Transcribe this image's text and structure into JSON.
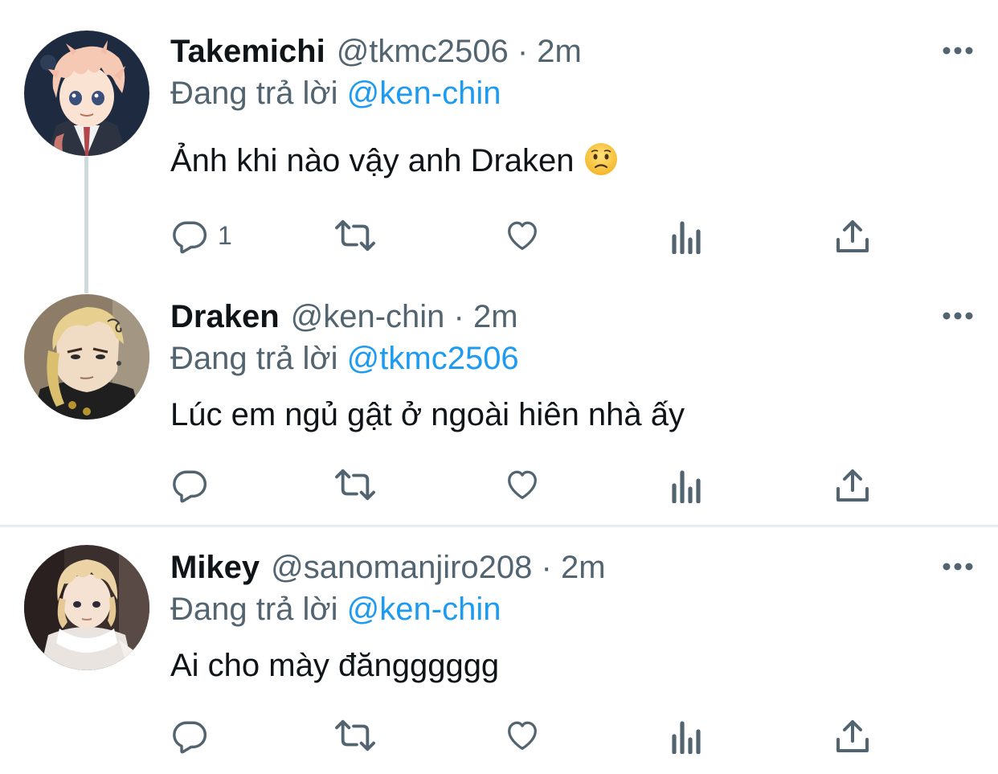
{
  "tweets": [
    {
      "name": "Takemichi",
      "handle": "@tkmc2506",
      "time": "· 2m",
      "reply_prefix": "Đang trả lời ",
      "reply_to": "@ken-chin",
      "text": "Ảnh khi nào vậy anh Draken",
      "emoji": "worried-face-emoji",
      "reply_count": "1"
    },
    {
      "name": "Draken",
      "handle": "@ken-chin",
      "time": "· 2m",
      "reply_prefix": "Đang trả lời ",
      "reply_to": "@tkmc2506",
      "text": "Lúc em ngủ gật ở ngoài hiên nhà ấy",
      "reply_count": ""
    },
    {
      "name": "Mikey",
      "handle": "@sanomanjiro208",
      "time": "· 2m",
      "reply_prefix": "Đang trả lời ",
      "reply_to": "@ken-chin",
      "text": "Ai cho mày đăngggggg",
      "reply_count": ""
    }
  ],
  "icons": {
    "reply": "reply-bubble-icon",
    "retweet": "retweet-icon",
    "like": "heart-icon",
    "views": "analytics-bars-icon",
    "share": "share-upload-icon",
    "more": "more-dots-icon"
  },
  "colors": {
    "text": "#0f1419",
    "secondary": "#536471",
    "mention": "#1d9bf0",
    "thread_line": "#cfd9de",
    "divider": "#e7ecef"
  }
}
